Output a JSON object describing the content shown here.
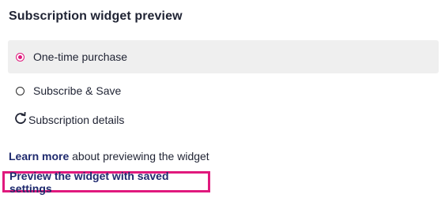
{
  "widget": {
    "title": "Subscription widget preview",
    "options": [
      {
        "label": "One-time purchase",
        "selected": true
      },
      {
        "label": "Subscribe & Save",
        "selected": false
      }
    ],
    "details_label": "Subscription details",
    "details_icon": "refresh-icon"
  },
  "footer": {
    "learn_more_link": "Learn more",
    "learn_more_text": " about previewing the widget",
    "preview_button": "Preview the widget with saved settings"
  },
  "colors": {
    "accent": "#e0197d",
    "link": "#1f2a6e",
    "selected_bg": "#efefef"
  }
}
